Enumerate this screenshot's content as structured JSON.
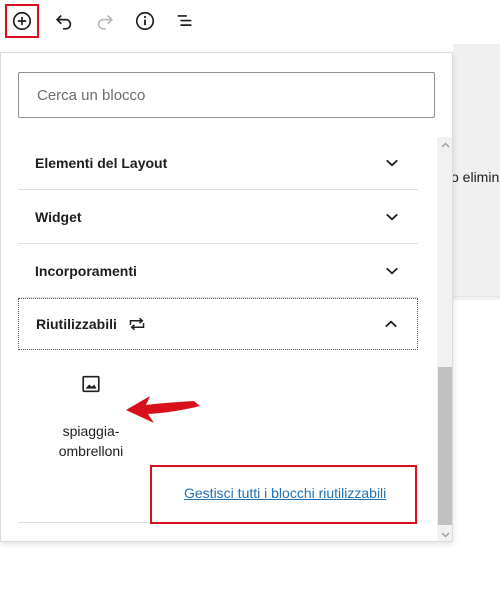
{
  "toolbar": {
    "add_icon": "plus-circle-icon",
    "undo_icon": "undo-icon",
    "redo_icon": "redo-icon",
    "info_icon": "info-icon",
    "list_icon": "list-view-icon"
  },
  "editor": {
    "partial_text": "o elimin"
  },
  "inserter": {
    "search": {
      "placeholder": "Cerca un blocco",
      "value": ""
    },
    "panels": [
      {
        "label": "Elementi del Layout",
        "expanded": false
      },
      {
        "label": "Widget",
        "expanded": false
      },
      {
        "label": "Incorporamenti",
        "expanded": false
      },
      {
        "label": "Riutilizzabili",
        "expanded": true,
        "icon": "reusable-block-icon"
      }
    ],
    "reusable_blocks": [
      {
        "label": "spiaggia-ombrelloni",
        "icon": "image-icon"
      }
    ],
    "manage_link": "Gestisci tutti i blocchi riutilizzabili"
  },
  "colors": {
    "annotation_red": "#d9101b",
    "link_blue": "#2271b1",
    "text": "#1e1e1e"
  }
}
